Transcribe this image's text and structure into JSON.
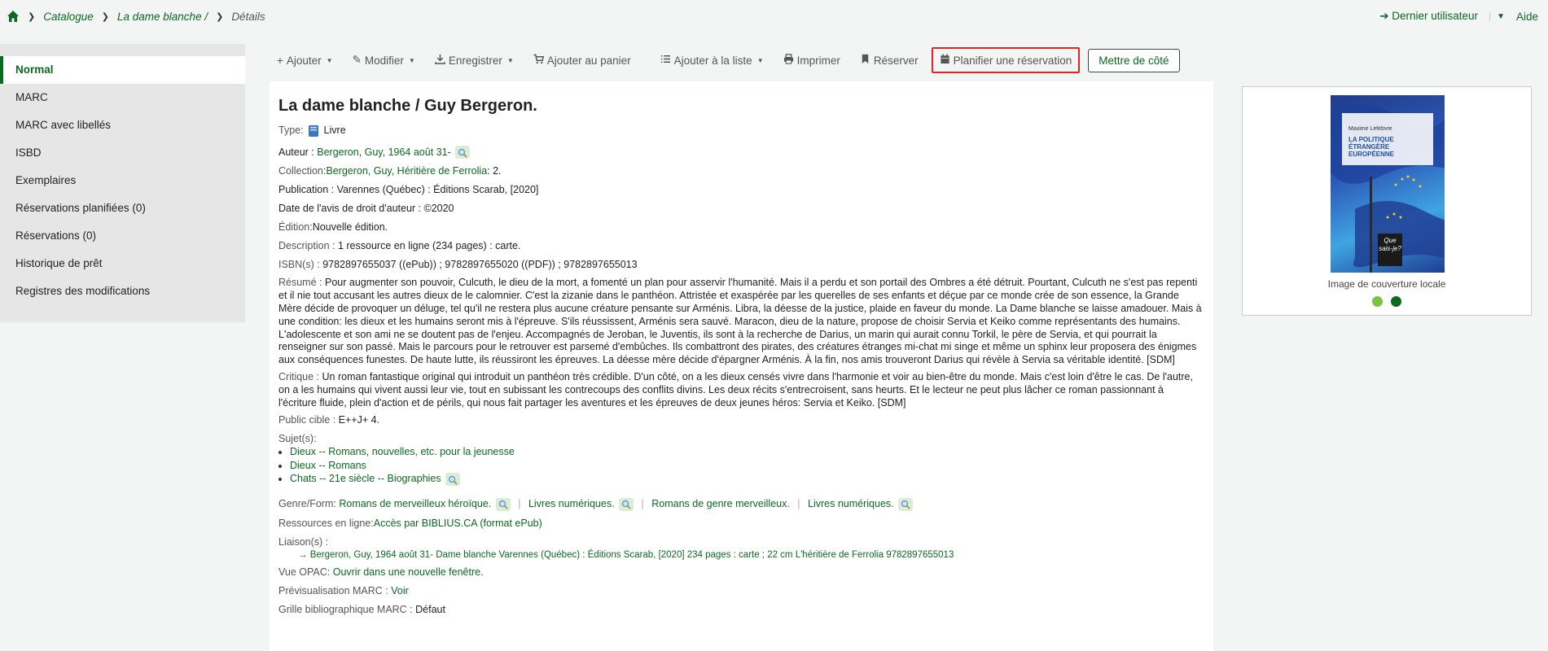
{
  "breadcrumb": {
    "items": [
      "Catalogue",
      "La dame blanche /",
      "Détails"
    ]
  },
  "topbar": {
    "last_user": "Dernier utilisateur",
    "help": "Aide"
  },
  "sidebar": {
    "items": [
      "Normal",
      "MARC",
      "MARC avec libellés",
      "ISBD",
      "Exemplaires",
      "Réservations planifiées (0)",
      "Réservations (0)",
      "Historique de prêt",
      "Registres des modifications"
    ]
  },
  "toolbar": {
    "add": "Ajouter",
    "edit": "Modifier",
    "save": "Enregistrer",
    "cart": "Ajouter au panier",
    "list": "Ajouter à la liste",
    "print": "Imprimer",
    "hold": "Réserver",
    "plan": "Planifier une réservation",
    "set_aside": "Mettre de côté"
  },
  "record": {
    "title": "La dame blanche / Guy Bergeron.",
    "type_label": "Type:",
    "type_value": "Livre",
    "author_label": "Auteur :",
    "author_value": "Bergeron, Guy, 1964 août 31-",
    "collection_label": "Collection:",
    "collection_value": "Bergeron, Guy, Héritière de Ferrolia",
    "collection_suffix": ": 2.",
    "publication": "Publication : Varennes (Québec) : Éditions Scarab, [2020]",
    "copyright": "Date de l'avis de droit d'auteur : ©2020",
    "edition_label": "Édition:",
    "edition_value": "Nouvelle édition.",
    "description_label": "Description :",
    "description_value": "1 ressource en ligne (234 pages) : carte.",
    "isbn_label": "ISBN(s) :",
    "isbn_value": "9782897655037 ((ePub)) ; 9782897655020 ((PDF)) ; 9782897655013",
    "summary_label": "Résumé :",
    "summary_value": "Pour augmenter son pouvoir, Culcuth, le dieu de la mort, a fomenté un plan pour asservir l'humanité. Mais il a perdu et son portail des Ombres a été détruit. Pourtant, Culcuth ne s'est pas repenti et il nie tout accusant les autres dieux de le calomnier. C'est la zizanie dans le panthéon. Attristée et exaspérée par les querelles de ses enfants et déçue par ce monde crée de son essence, la Grande Mère décide de provoquer un déluge, tel qu'il ne restera plus aucune créature pensante sur Arménis. Libra, la déesse de la justice, plaide en faveur du monde. La Dame blanche se laisse amadouer. Mais à une condition: les dieux et les humains seront mis à l'épreuve. S'ils réussissent, Arménis sera sauvé. Maracon, dieu de la nature, propose de choisir Servia et Keiko comme représentants des humains. L'adolescente et son ami ne se doutent pas de l'enjeu. Accompagnés de Jeroban, le Juventis, ils sont à la recherche de Darius, un marin qui aurait connu Torkil, le père de Servia, et qui pourrait la renseigner sur son passé. Mais le parcours pour le retrouver est parsemé d'embûches. Ils combattront des pirates, des créatures étranges mi-chat mi singe et même un sphinx leur proposera des énigmes aux conséquences funestes. De haute lutte, ils réussiront les épreuves. La déesse mère décide d'épargner Arménis. À la fin, nos amis trouveront Darius qui révèle à Servia sa véritable identité. [SDM]",
    "review_label": "Critique :",
    "review_value": "Un roman fantastique original qui introduit un panthéon très crédible. D'un côté, on a les dieux censés vivre dans l'harmonie et voir au bien-être du monde. Mais c'est loin d'être le cas. De l'autre, on a les humains qui vivent aussi leur vie, tout en subissant les contrecoups des conflits divins. Les deux récits s'entrecroisent, sans heurts. Et le lecteur ne peut plus lâcher ce roman passionnant à l'écriture fluide, plein d'action et de périls, qui nous fait partager les aventures et les épreuves de deux jeunes héros: Servia et Keiko. [SDM]",
    "audience_label": "Public cible :",
    "audience_value": "E++J+ 4.",
    "subjects_label": "Sujet(s):",
    "subjects": [
      "Dieux -- Romans, nouvelles, etc. pour la jeunesse",
      "Dieux -- Romans",
      "Chats -- 21e siècle -- Biographies"
    ],
    "genre_label": "Genre/Form:",
    "genres": [
      "Romans de merveilleux héroïque.",
      "Livres numériques.",
      "Romans de genre merveilleux.",
      "Livres numériques."
    ],
    "online_label": "Ressources en ligne:",
    "online_value": "Accès par BIBLIUS.CA (format ePub)",
    "links_label": "Liaison(s) :",
    "links_value": "→ Bergeron, Guy, 1964 août 31- Dame blanche Varennes (Québec) : Éditions Scarab, [2020] 234 pages : carte ; 22 cm L'héritière de Ferrolia 9782897655013",
    "opac_label": "Vue OPAC:",
    "opac_value": "Ouvrir dans une nouvelle fenêtre.",
    "marc_preview_label": "Prévisualisation MARC :",
    "marc_preview_value": "Voir",
    "marc_framework_label": "Grille bibliographique MARC :",
    "marc_framework_value": "Défaut"
  },
  "cover": {
    "caption": "Image de couverture locale",
    "book_author": "Maxime Lefebvre",
    "book_title": "LA POLITIQUE ÉTRANGÈRE EUROPÉENNE",
    "series_mark": "Que sais-je?",
    "dot_colors": [
      "#7cc242",
      "#0a6a1f"
    ]
  },
  "colors": {
    "accent": "#0a6a1f",
    "highlight_border": "#d62828"
  }
}
